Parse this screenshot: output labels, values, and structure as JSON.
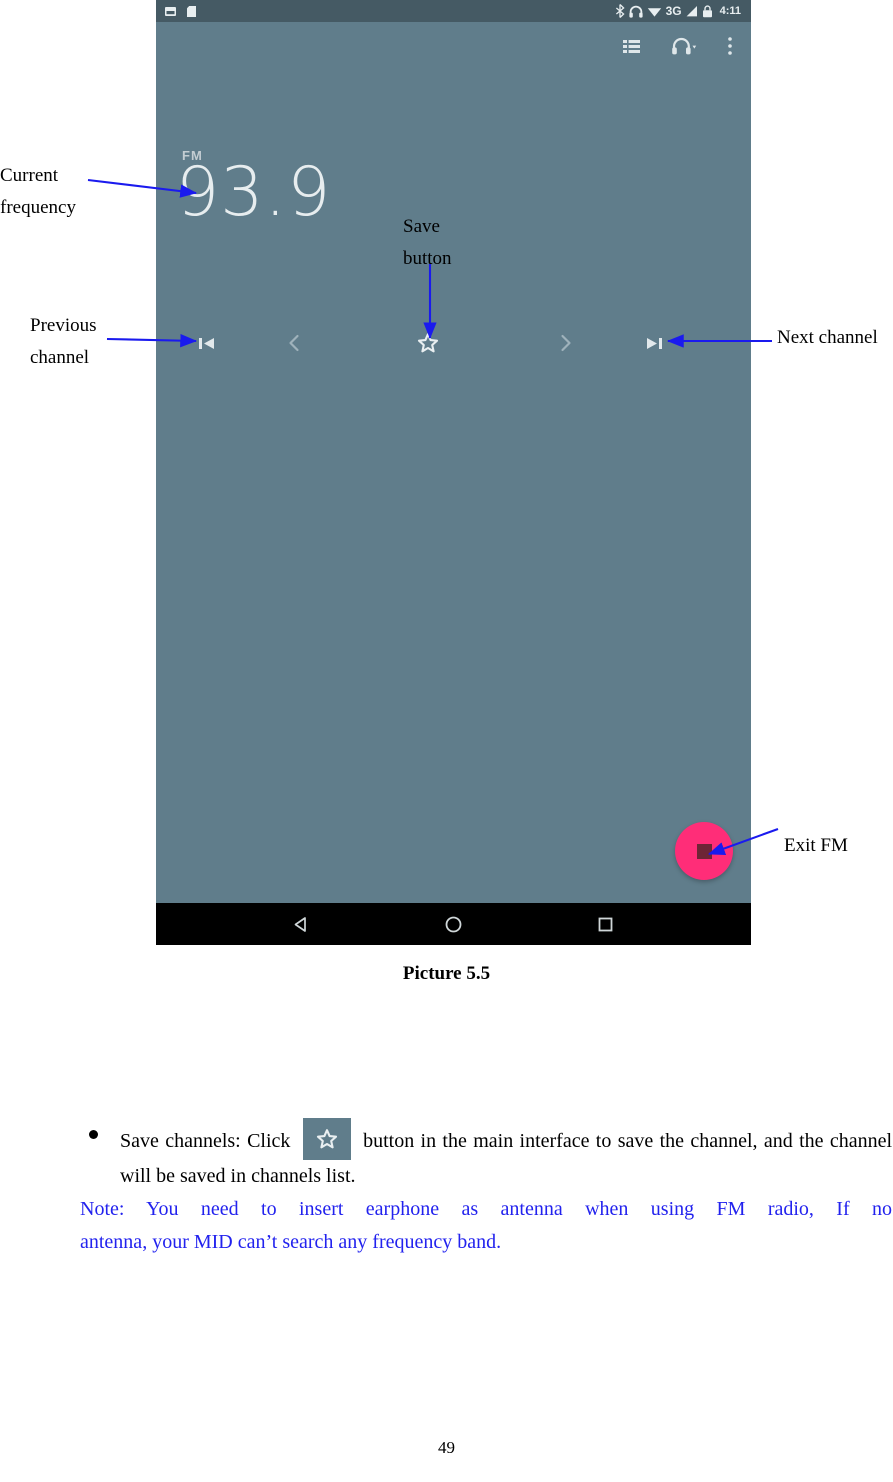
{
  "phone": {
    "statusbar": {
      "icons_left": [
        "sim-card-icon",
        "sd-card-icon"
      ],
      "icons_right": [
        "bluetooth-icon",
        "headphone-icon",
        "wifi-icon",
        "signal-icon",
        "lock-icon"
      ],
      "network_label": "3G",
      "time": "4:11"
    },
    "toolbar": {
      "channel_list_label": "list-icon",
      "headphone_label": "headphone-icon",
      "overflow_label": "more-vert-icon"
    },
    "display": {
      "band": "FM",
      "frequency": "93.9"
    },
    "controls": [
      {
        "name": "previous-channel-button",
        "icon": "skip-previous-icon"
      },
      {
        "name": "tune-down-button",
        "icon": "chevron-left-icon"
      },
      {
        "name": "save-channel-button",
        "icon": "star-outline-icon"
      },
      {
        "name": "tune-up-button",
        "icon": "chevron-right-icon"
      },
      {
        "name": "next-channel-button",
        "icon": "skip-next-icon"
      }
    ],
    "fab": {
      "name": "exit-fm-button",
      "icon": "stop-square-icon"
    },
    "navbar": [
      {
        "name": "nav-back-button",
        "icon": "back-triangle-icon"
      },
      {
        "name": "nav-home-button",
        "icon": "home-circle-icon"
      },
      {
        "name": "nav-recents-button",
        "icon": "recents-square-icon"
      }
    ],
    "colors": {
      "background": "#607d8b",
      "statusbar": "#455a64",
      "fab": "#ff2d78",
      "fab_icon": "#6e2536",
      "navbar": "#000000"
    }
  },
  "annotations": {
    "current_frequency": "Current\nfrequency",
    "previous_channel": "Previous\nchannel",
    "save_button": "Save\nbutton",
    "next_channel": "Next channel",
    "exit_fm": "Exit FM",
    "arrow_color": "#1a1aee"
  },
  "caption": "Picture 5.5",
  "body": {
    "bullet_before": "Save channels: Click",
    "bullet_after": "button in the main interface to save the channel, and the channel will be saved in channels list.",
    "note_line1": "Note: You need to insert earphone as antenna when using FM radio, If no",
    "note_line2": "antenna, your MID can’t search any frequency band.",
    "note_color": "#2222ee"
  },
  "page_number": "49"
}
